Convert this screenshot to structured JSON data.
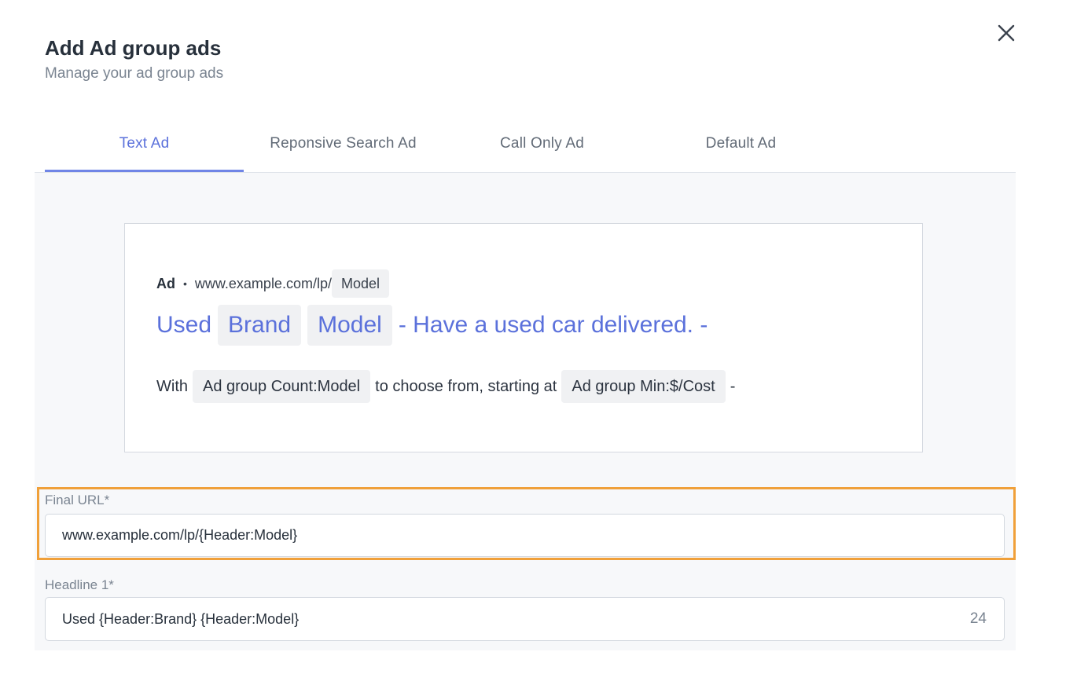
{
  "dialog": {
    "title": "Add Ad group ads",
    "subtitle": "Manage your ad group ads",
    "close_icon": "close-icon"
  },
  "tabs": [
    {
      "label": "Text Ad",
      "active": true
    },
    {
      "label": "Reponsive Search Ad",
      "active": false
    },
    {
      "label": "Call Only Ad",
      "active": false
    },
    {
      "label": "Default Ad",
      "active": false
    }
  ],
  "preview": {
    "ad_label": "Ad",
    "separator": "•",
    "url_prefix": "www.example.com/lp/",
    "url_chip": "Model",
    "headline_prefix": "Used",
    "headline_chip_1": "Brand",
    "headline_chip_2": "Model",
    "headline_suffix": "- Have a used car delivered. -",
    "desc_prefix": "With",
    "desc_chip_1": "Ad group Count:Model",
    "desc_middle": "to choose from, starting at",
    "desc_chip_2": "Ad group Min:$/Cost",
    "desc_suffix": "-"
  },
  "fields": {
    "final_url": {
      "label": "Final URL*",
      "value": "www.example.com/lp/{Header:Model}"
    },
    "headline_1": {
      "label": "Headline 1*",
      "value": "Used {Header:Brand} {Header:Model}",
      "count": "24"
    }
  },
  "colors": {
    "accent": "#5b71db",
    "highlight": "#f0a03a"
  }
}
